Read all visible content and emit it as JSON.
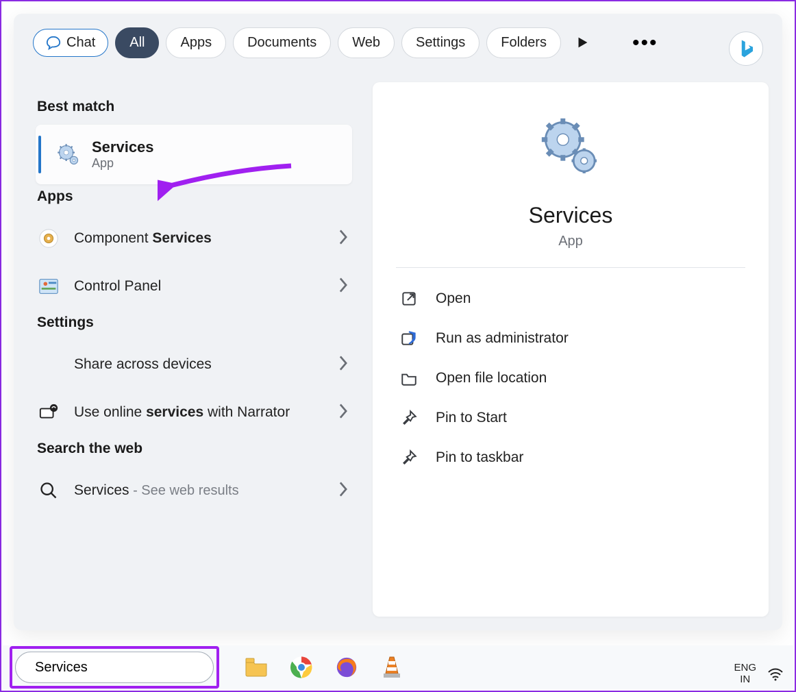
{
  "filters": {
    "chat": "Chat",
    "all": "All",
    "apps": "Apps",
    "documents": "Documents",
    "web": "Web",
    "settings": "Settings",
    "folders": "Folders"
  },
  "sections": {
    "best_match": "Best match",
    "apps": "Apps",
    "settings": "Settings",
    "search_web": "Search the web"
  },
  "best_match": {
    "title": "Services",
    "subtitle": "App"
  },
  "apps_results": {
    "component_prefix": "Component ",
    "component_bold": "Services",
    "control_panel": "Control Panel"
  },
  "settings_results": {
    "share_across": "Share across devices",
    "narrator_prefix": "Use online ",
    "narrator_bold": "services",
    "narrator_suffix": " with Narrator"
  },
  "web_results": {
    "query": "Services",
    "suffix": " - See web results"
  },
  "detail": {
    "title": "Services",
    "subtitle": "App",
    "actions": {
      "open": "Open",
      "run_admin": "Run as administrator",
      "open_loc": "Open file location",
      "pin_start": "Pin to Start",
      "pin_taskbar": "Pin to taskbar"
    }
  },
  "taskbar": {
    "search_value": "Services",
    "lang1": "ENG",
    "lang2": "IN"
  }
}
